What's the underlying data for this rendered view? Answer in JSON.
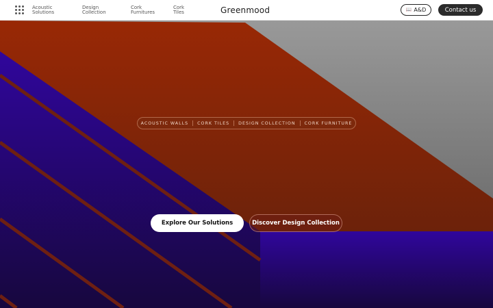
{
  "header": {
    "menu_icon": "grid-menu-icon",
    "nav": [
      {
        "line1": "Acoustic",
        "line2": "Solutions"
      },
      {
        "line1": "Design",
        "line2": "Collection"
      },
      {
        "line1": "Cork",
        "line2": "Furnitures"
      },
      {
        "line1": "Cork",
        "line2": "Tiles"
      }
    ],
    "logo": "Greenmood",
    "ad_icon": "book-icon",
    "ad_label": "A&D",
    "contact_label": "Contact us"
  },
  "hero": {
    "tags": [
      "ACOUSTIC WALLS",
      "CORK TILES",
      "DESIGN COLLECTION",
      "CORK FURNITURE"
    ],
    "primary_button": "Explore Our Solutions",
    "secondary_button": "Discover Design Collection"
  },
  "colors": {
    "orange_top": "#992805",
    "orange_bottom": "#5c200c",
    "purple_top": "#30069c",
    "purple_bottom": "#17073e",
    "gray_top": "#999999",
    "gray_bottom": "#5a5a5a",
    "contact_bg": "#2b2b2b"
  }
}
